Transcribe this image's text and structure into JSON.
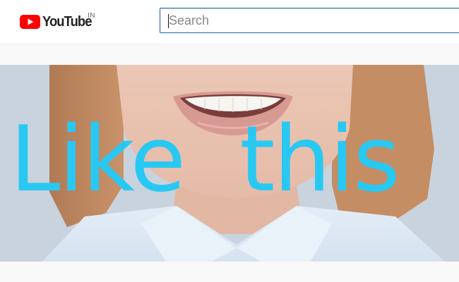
{
  "header": {
    "logo": {
      "wordmark": "YouTube",
      "country_code": "IN",
      "brand_color": "#ff0000"
    },
    "search": {
      "placeholder": "Search",
      "value": "",
      "focus_color": "#1c62b9"
    }
  },
  "video": {
    "caption": {
      "words": [
        "Like",
        "this"
      ],
      "color": "#29c8f3"
    }
  }
}
